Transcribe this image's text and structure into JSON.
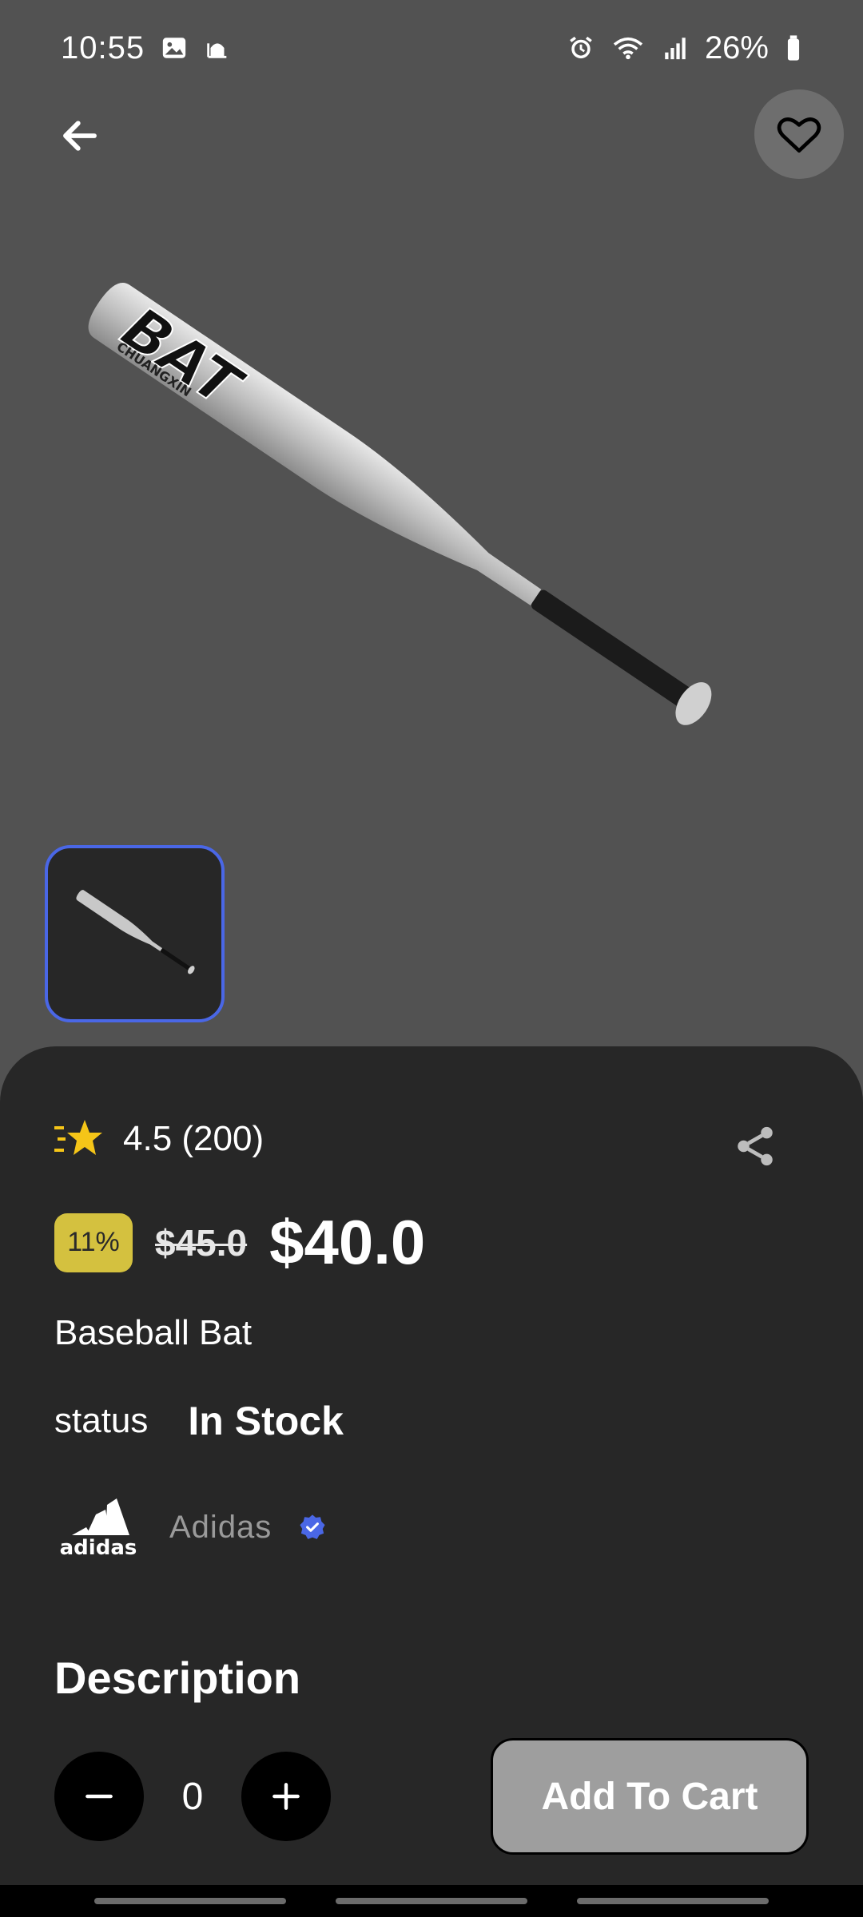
{
  "status_bar": {
    "time": "10:55",
    "battery_percent": "26%",
    "icons_left": [
      "gallery-icon",
      "mosque-icon"
    ],
    "icons_right": [
      "alarm-icon",
      "wifi-icon",
      "signal-icon",
      "battery-icon"
    ]
  },
  "header": {
    "back_icon": "arrow-left-icon",
    "favorite_icon": "heart-icon"
  },
  "product": {
    "hero_image_text": "BAT",
    "hero_image_subtext": "CHUANGXIN",
    "rating": "4.5 (200)",
    "discount": "11%",
    "old_price": "$45.0",
    "new_price": "$40.0",
    "name": "Baseball Bat",
    "status_label": "status",
    "status_value": "In Stock",
    "brand_name": "Adidas",
    "brand_logo_text": "adidas",
    "description_title": "Description"
  },
  "cart": {
    "quantity": "0",
    "add_label": "Add To Cart"
  },
  "colors": {
    "background": "#525252",
    "sheet": "#272727",
    "accent_blue": "#4a67e6",
    "discount_yellow": "#d4c13f",
    "star": "#f5c518",
    "button_gray": "#9e9e9e"
  }
}
